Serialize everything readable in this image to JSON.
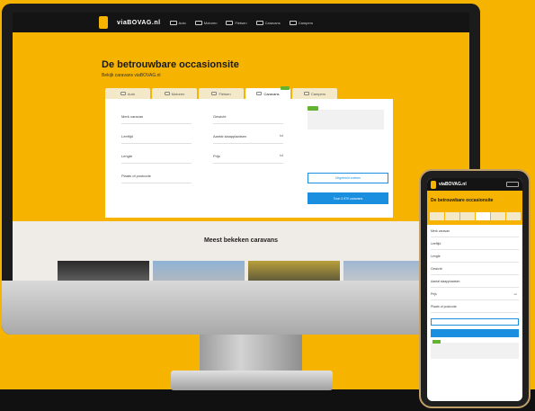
{
  "desktop": {
    "nav": {
      "logo": "viaBOVAG.nl",
      "items": [
        "Auto",
        "Motoren",
        "Fietsen",
        "Caravans",
        "Campers"
      ]
    },
    "hero": {
      "title": "De betrouwbare occasionsite",
      "subtitle": "Bekijk caravans viaBOVAG.nl"
    },
    "form": {
      "fields_left": [
        "Merk caravan",
        "Leeftijd",
        "Lengte",
        "Plaats of postcode"
      ],
      "fields_right": [
        "Gewicht",
        "Aantal slaapplaatsen",
        "Prijs",
        ""
      ],
      "button_outline": "Uitgebreid zoeken",
      "button_primary": "Toon 2.970 caravans"
    },
    "section_title": "Meest bekeken caravans"
  },
  "phone": {
    "nav_logo": "viaBOVAG.nl",
    "title": "De betrouwbare occasionsite",
    "fields": [
      "Merk caravan",
      "Leeftijd",
      "Lengte",
      "Gewicht",
      "Aantal slaapplaatsen",
      "Prijs",
      "Plaats of postcode"
    ]
  },
  "colors": {
    "brand_yellow": "#f6b400",
    "accent_blue": "#1a8fe0",
    "badge_green": "#63b32e"
  }
}
